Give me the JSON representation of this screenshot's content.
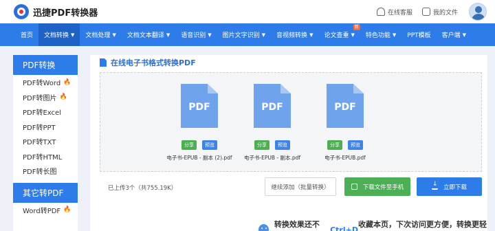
{
  "header": {
    "brand": "迅捷PDF转换器",
    "links": [
      {
        "label": "在线客服",
        "icon": "headset-icon"
      },
      {
        "label": "我的文件",
        "icon": "file-icon"
      }
    ]
  },
  "nav": {
    "items": [
      {
        "label": "首页",
        "caret": false
      },
      {
        "label": "文档转换",
        "caret": true,
        "active": true
      },
      {
        "label": "文档处理",
        "caret": true
      },
      {
        "label": "文档文本翻译",
        "caret": true
      },
      {
        "label": "语音识别",
        "caret": true
      },
      {
        "label": "图片文字识别",
        "caret": true
      },
      {
        "label": "音视频转换",
        "caret": true
      },
      {
        "label": "论文查重",
        "caret": true,
        "badge": "新"
      },
      {
        "label": "特色功能",
        "caret": true
      },
      {
        "label": "PPT模板",
        "caret": false
      },
      {
        "label": "客户端",
        "caret": true
      }
    ]
  },
  "sidebar": {
    "section1": "PDF转换",
    "items1": [
      {
        "label": "PDF转Word",
        "hot": true
      },
      {
        "label": "PDF转图片",
        "hot": true
      },
      {
        "label": "PDF转Excel",
        "hot": false
      },
      {
        "label": "PDF转PPT",
        "hot": false
      },
      {
        "label": "PDF转TXT",
        "hot": false
      },
      {
        "label": "PDF转HTML",
        "hot": false
      },
      {
        "label": "PDF转长图",
        "hot": false
      }
    ],
    "section2": "其它转PDF",
    "items2": [
      {
        "label": "Word转PDF",
        "hot": true
      }
    ]
  },
  "main": {
    "title": "在线电子书格式转换PDF",
    "files": [
      {
        "icon_label": "PDF",
        "share": "分享",
        "preview": "预览",
        "name": "电子书-EPUB - 副本 (2).pdf"
      },
      {
        "icon_label": "PDF",
        "share": "分享",
        "preview": "预览",
        "name": "电子书-EPUB - 副本.pdf"
      },
      {
        "icon_label": "PDF",
        "share": "分享",
        "preview": "预览",
        "name": "电子书-EPUB.pdf"
      }
    ],
    "uploaded": "已上传3个（共755.19K）",
    "continue_label": "继续添加（批量转换）",
    "phone_label": "下载文件至手机",
    "download_label": "立即下载"
  },
  "promo": {
    "prefix": "转换效果还不错?",
    "shortcut": "Ctrl+D",
    "suffix": "收藏本页，下次访问更方便，转换更轻松!"
  },
  "colors": {
    "primary": "#2d7cea",
    "green": "#4cae55",
    "hot": "#ff6a2e"
  }
}
